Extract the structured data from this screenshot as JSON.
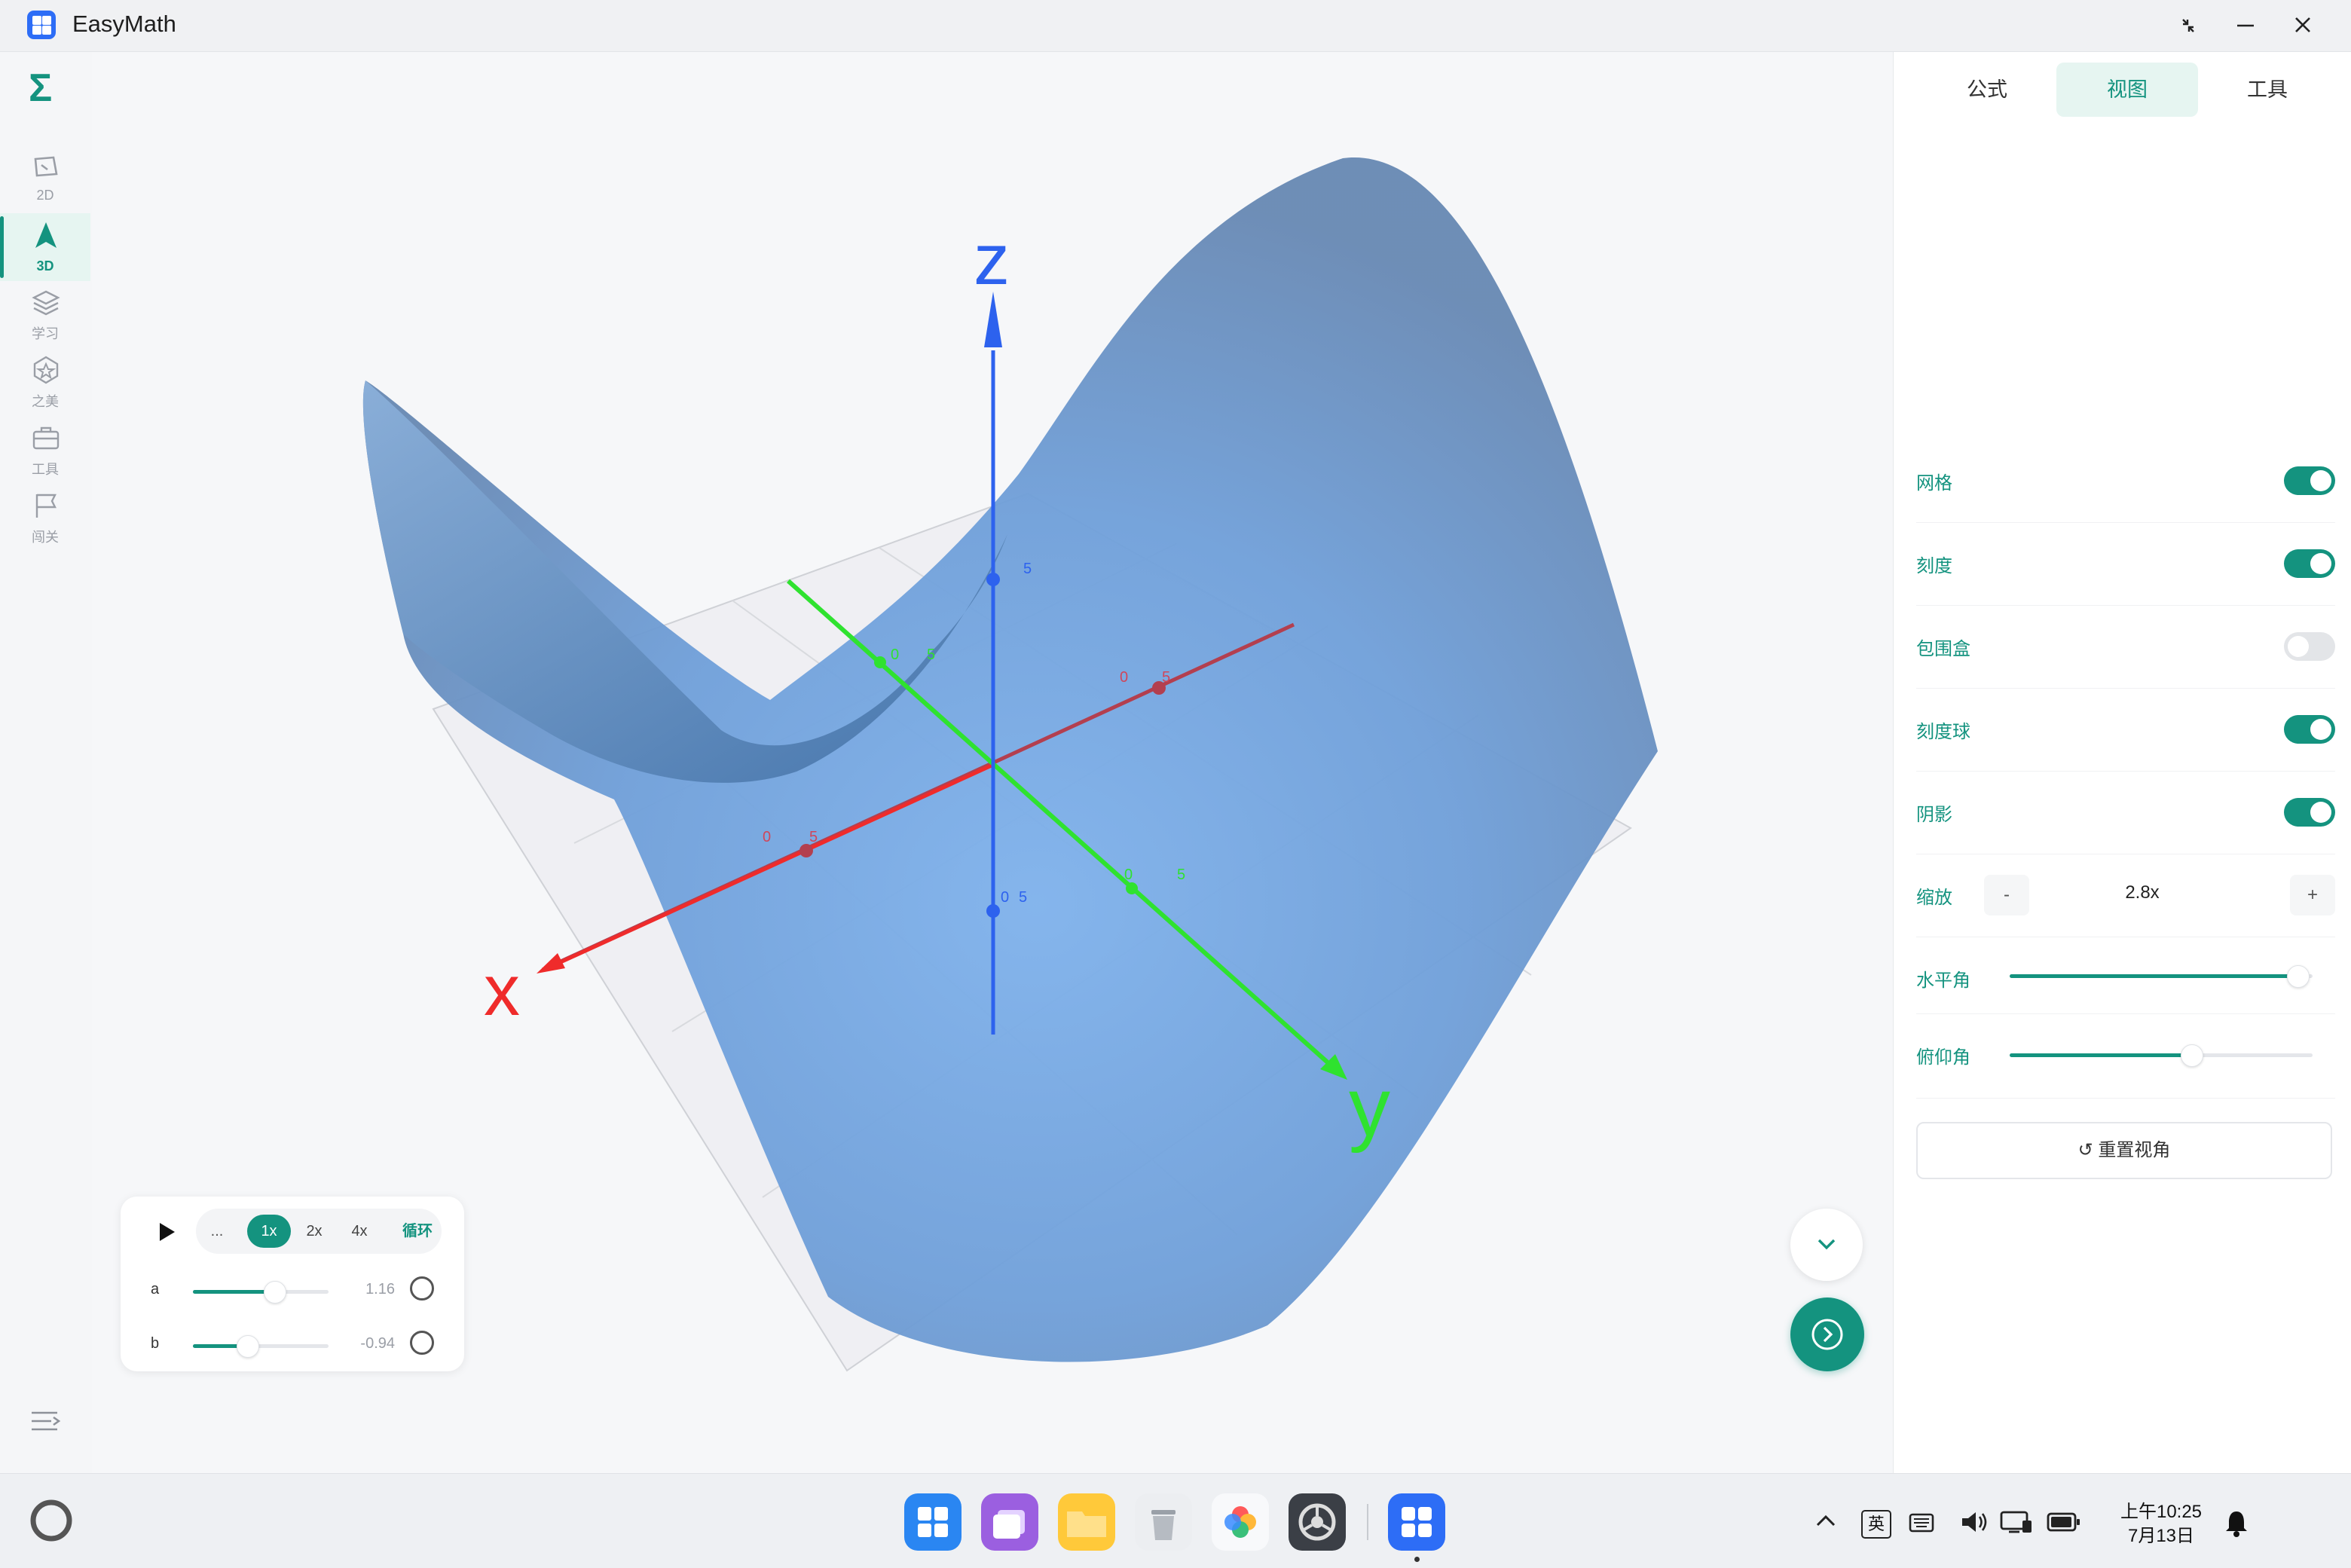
{
  "app": {
    "title": "EasyMath"
  },
  "sidebar": {
    "items": [
      {
        "label": "2D"
      },
      {
        "label": "3D"
      },
      {
        "label": "学习"
      },
      {
        "label": "之美"
      },
      {
        "label": "工具"
      },
      {
        "label": "闯关"
      }
    ],
    "active": "3D"
  },
  "panel": {
    "tabs": [
      "公式",
      "视图",
      "工具"
    ],
    "active_tab": "视图",
    "toggles": [
      {
        "label": "网格",
        "on": true
      },
      {
        "label": "刻度",
        "on": true
      },
      {
        "label": "包围盒",
        "on": false
      },
      {
        "label": "刻度球",
        "on": true
      },
      {
        "label": "阴影",
        "on": true
      }
    ],
    "zoom": {
      "label": "缩放",
      "minus": "-",
      "value": "2.8x",
      "plus": "+"
    },
    "horizontal_angle": {
      "label": "水平角",
      "value_fraction": 0.95
    },
    "pitch_angle": {
      "label": "俯仰角",
      "value_fraction": 0.6
    },
    "reset_label": "↺ 重置视角"
  },
  "animation": {
    "more": "...",
    "speeds": [
      "1x",
      "2x",
      "4x"
    ],
    "active_speed": "1x",
    "loop_label": "循环",
    "params": [
      {
        "name": "a",
        "value": "1.16",
        "fraction": 0.6
      },
      {
        "name": "b",
        "value": "-0.94",
        "fraction": 0.4
      }
    ]
  },
  "scene": {
    "axis_labels": {
      "x": "x",
      "y": "y",
      "z": "z"
    },
    "tick_labels": [
      "0",
      "5"
    ],
    "colors": {
      "x_axis": "#ef2b2b",
      "y_axis": "#2fe22f",
      "z_axis": "#2d62ee",
      "surface": "#6f9fdc",
      "accent": "#14937f"
    }
  },
  "taskbar": {
    "ime": "英",
    "time": "上午10:25",
    "date": "7月13日"
  }
}
